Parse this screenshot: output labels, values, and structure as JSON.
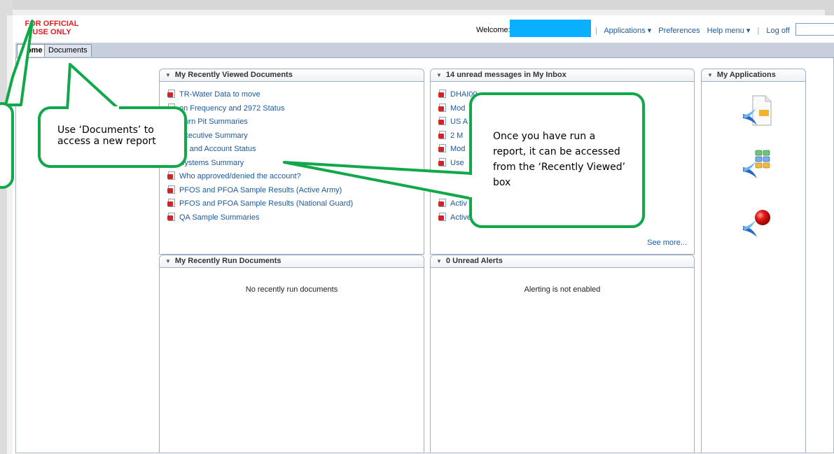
{
  "header": {
    "logo_text": "FOR OFFICIAL USE ONLY",
    "welcome_label": "Welcome:",
    "nav": [
      "Applications ▾",
      "Preferences",
      "Help menu ▾",
      "Log off"
    ]
  },
  "tabs": [
    "Home",
    "Documents"
  ],
  "recently_viewed": {
    "title": "My Recently Viewed Documents",
    "items": [
      "TR-Water Data to move",
      "on Frequency and 2972 Status",
      "Burn Pit Summaries",
      "Executive Summary",
      "es and Account Status",
      "Systems Summary",
      "Who approved/denied the account?",
      "PFOS and PFOA Sample Results (Active Army)",
      "PFOS and PFOA Sample Results (National Guard)",
      "QA Sample Summaries"
    ]
  },
  "inbox": {
    "title": "14 unread messages in My Inbox",
    "items": [
      "DHAI00",
      "Mod",
      "US A",
      "2 M",
      "Mod",
      "Use",
      "",
      "",
      "Activ",
      "Active"
    ],
    "see_more": "See more..."
  },
  "my_apps": {
    "title": "My Applications",
    "icons": [
      "document-app-icon",
      "module-grid-icon",
      "red-ball-app-icon"
    ]
  },
  "recently_run": {
    "title": "My Recently Run Documents",
    "empty_text": "No recently run documents"
  },
  "alerts": {
    "title": "0 Unread Alerts",
    "empty_text": "Alerting is not enabled"
  },
  "callouts": {
    "documents": "Use ‘Documents’ to access a new report",
    "recently_viewed": "Once you have run a report, it can be accessed from the ‘Recently Viewed’ box"
  },
  "colors": {
    "link": "#1a5a9c",
    "callout_border": "#11a84a",
    "welcome_redaction": "#0aafff",
    "logo_red": "#e02020"
  }
}
